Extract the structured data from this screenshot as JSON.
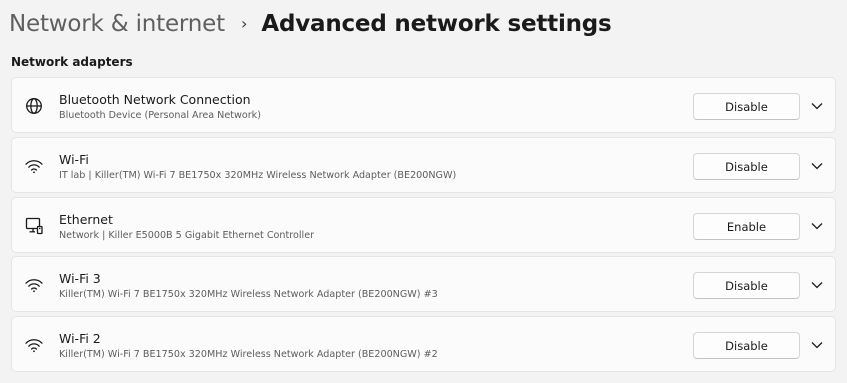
{
  "breadcrumb": {
    "parent": "Network & internet",
    "separator": "›",
    "current": "Advanced network settings"
  },
  "section": {
    "title": "Network adapters"
  },
  "adapters": [
    {
      "icon": "globe-icon",
      "title": "Bluetooth Network Connection",
      "subtitle": "Bluetooth Device (Personal Area Network)",
      "action": "Disable"
    },
    {
      "icon": "wifi-icon",
      "title": "Wi-Fi",
      "subtitle": "IT lab | Killer(TM) Wi-Fi 7 BE1750x 320MHz Wireless Network Adapter (BE200NGW)",
      "action": "Disable"
    },
    {
      "icon": "ethernet-icon",
      "title": "Ethernet",
      "subtitle": "Network | Killer E5000B 5 Gigabit Ethernet Controller",
      "action": "Enable"
    },
    {
      "icon": "wifi-icon",
      "title": "Wi-Fi 3",
      "subtitle": "Killer(TM) Wi-Fi 7 BE1750x 320MHz Wireless Network Adapter (BE200NGW) #3",
      "action": "Disable"
    },
    {
      "icon": "wifi-icon",
      "title": "Wi-Fi 2",
      "subtitle": "Killer(TM) Wi-Fi 7 BE1750x 320MHz Wireless Network Adapter (BE200NGW) #2",
      "action": "Disable"
    }
  ]
}
